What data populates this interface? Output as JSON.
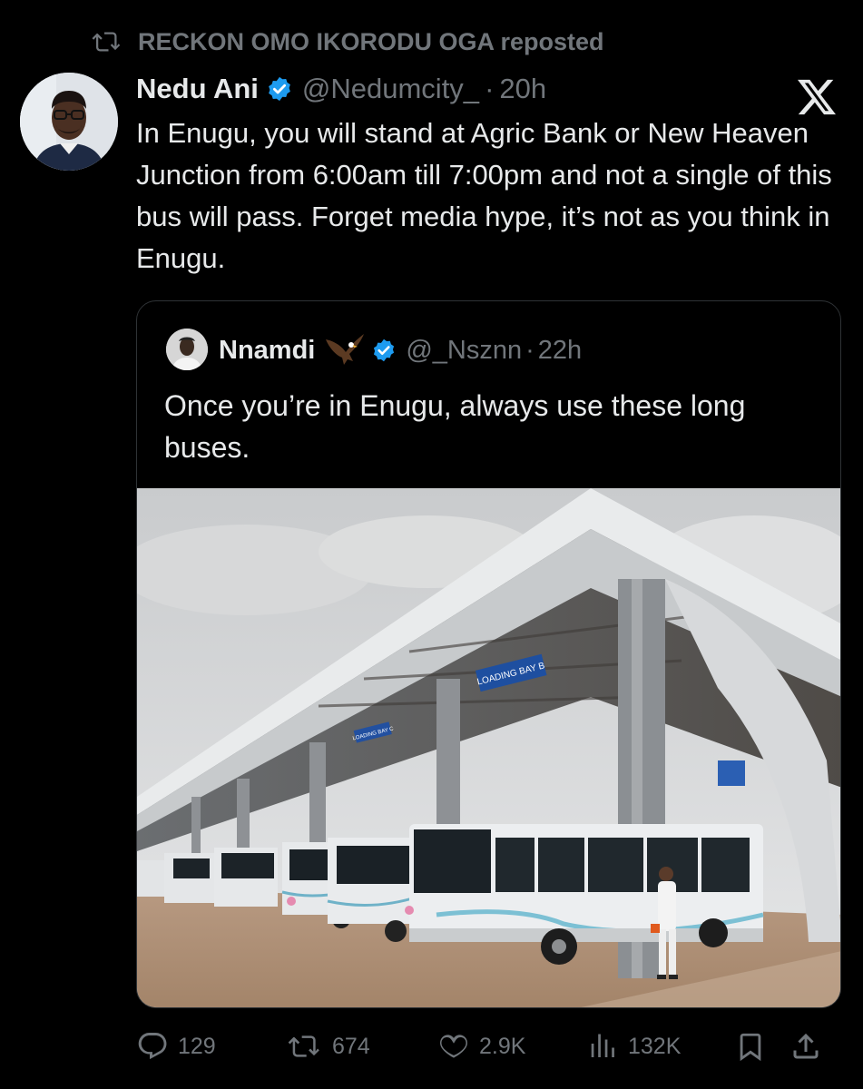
{
  "repost": {
    "icon": "repost-icon",
    "text": "RECKON OMO IKORODU OGA reposted"
  },
  "tweet": {
    "name": "Nedu Ani",
    "handle": "@Nedumcity_",
    "separator": "·",
    "time": "20h",
    "text": "In Enugu, you will stand at Agric Bank or New Heaven Junction from 6:00am till 7:00pm and not a single of this bus will pass. Forget media hype, it’s not as you think in Enugu."
  },
  "quote": {
    "name": "Nnamdi",
    "emoji": "eagle-emoji",
    "handle": "@_Nsznn",
    "separator": "·",
    "time": "22h",
    "text": "Once you’re in Enugu, always use these long buses.",
    "sign_main": "LOADING BAY B",
    "sign_small": "LOADING BAY C"
  },
  "actions": {
    "replies": "129",
    "reposts": "674",
    "likes": "2.9K",
    "views": "132K"
  },
  "colors": {
    "accent": "#1d9bf0",
    "muted": "#71767b",
    "text": "#e7e9ea",
    "background": "#000000"
  }
}
